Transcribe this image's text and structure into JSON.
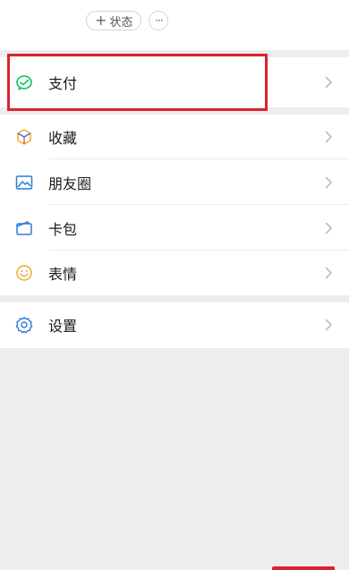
{
  "header": {
    "status_label": "状态",
    "plus_glyph": "+",
    "more_glyph": "···"
  },
  "menu": {
    "pay": "支付",
    "favorites": "收藏",
    "moments": "朋友圈",
    "cards": "卡包",
    "stickers": "表情",
    "settings": "设置"
  },
  "colors": {
    "pay_icon": "#07c160",
    "favorites_icon": "#f0a830",
    "moments_icon": "#2d7bd8",
    "cards_icon": "#2d7bd8",
    "stickers_icon": "#f0a830",
    "settings_icon": "#2d7bd8",
    "highlight": "#d9242f"
  },
  "icons": {
    "pay": "wechat-pay-icon",
    "favorites": "cube-icon",
    "moments": "image-icon",
    "cards": "wallet-icon",
    "stickers": "smiley-icon",
    "settings": "gear-icon",
    "chevron": "chevron-right-icon"
  }
}
